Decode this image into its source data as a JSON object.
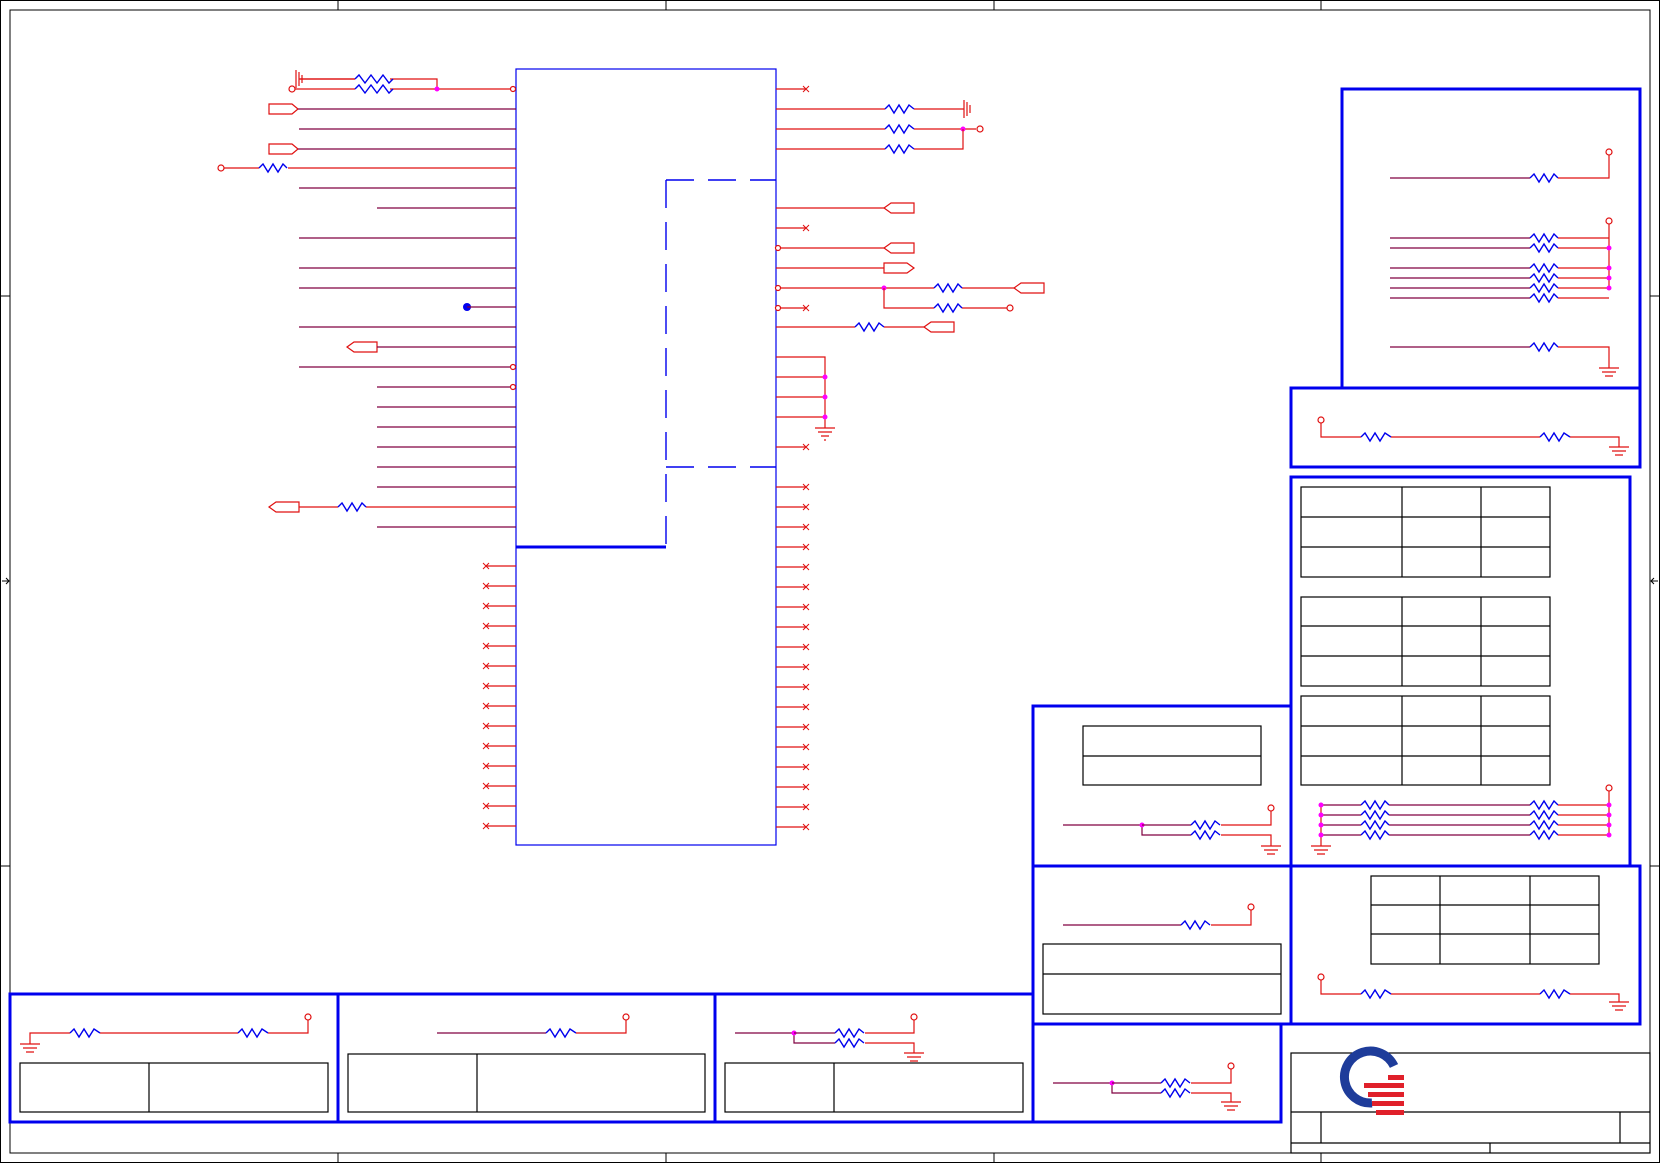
{
  "sheet": {
    "title": "",
    "logo": "company-logo",
    "colors": {
      "wire": "#e01010",
      "bus": "#0000ee",
      "junction": "#ff00ff",
      "logo_blue": "#1e3c9a",
      "logo_red": "#e0202a",
      "border": "#000000"
    }
  }
}
